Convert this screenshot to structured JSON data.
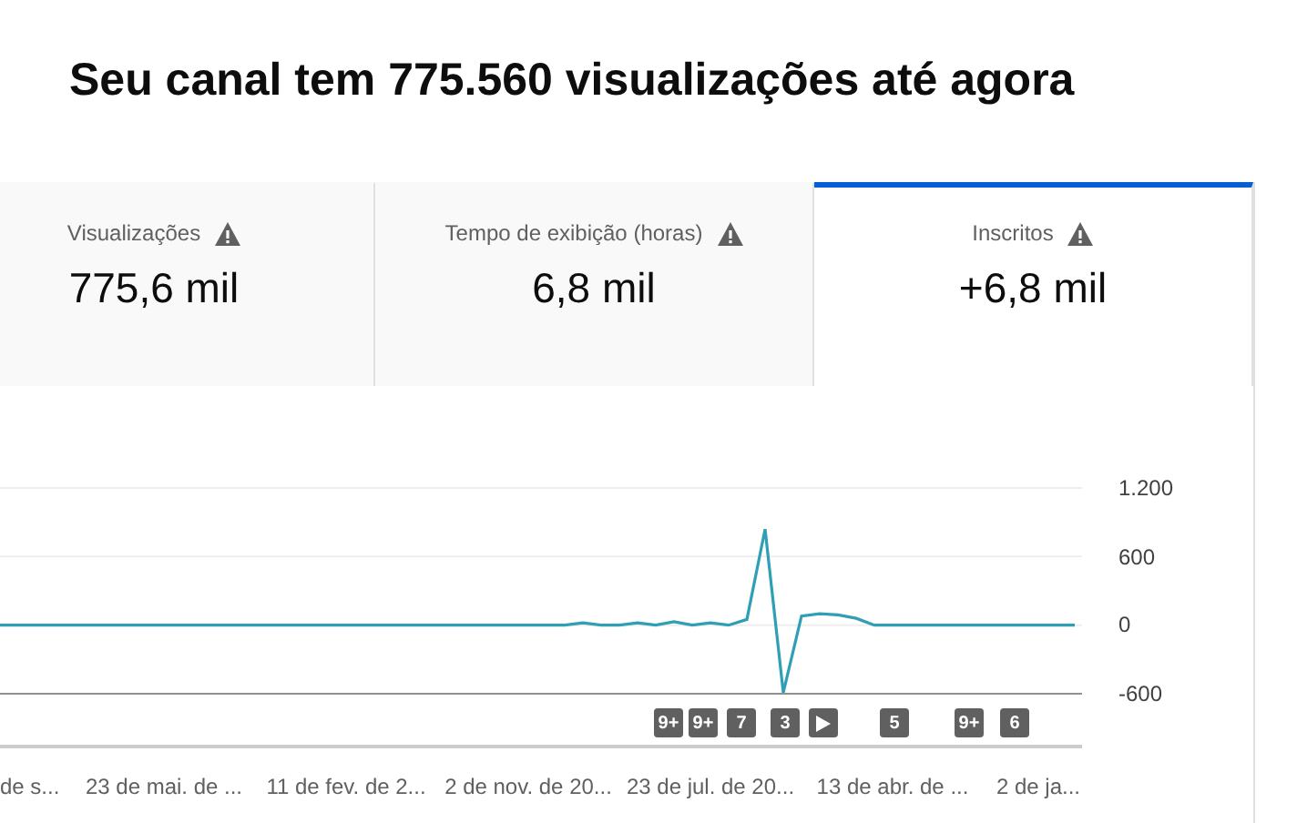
{
  "title": "Seu canal tem 775.560 visualizações até agora",
  "tabs": [
    {
      "label": "Visualizações",
      "value": "775,6 mil",
      "selected": false
    },
    {
      "label": "Tempo de exibição (horas)",
      "value": "6,8 mil",
      "selected": false
    },
    {
      "label": "Inscritos",
      "value": "+6,8 mil",
      "selected": true
    }
  ],
  "chart": {
    "chart_data": {
      "type": "line",
      "ylim": [
        -600,
        1200
      ],
      "yticks": [
        {
          "value": 1200,
          "label": "1.200"
        },
        {
          "value": 600,
          "label": "600"
        },
        {
          "value": 0,
          "label": "0"
        },
        {
          "value": -600,
          "label": "-600"
        }
      ],
      "series": [
        {
          "color": "#2f9fb5",
          "values": [
            0,
            0,
            0,
            0,
            0,
            0,
            0,
            0,
            0,
            0,
            0,
            0,
            0,
            0,
            0,
            0,
            0,
            0,
            0,
            0,
            0,
            0,
            0,
            0,
            0,
            0,
            0,
            0,
            0,
            0,
            0,
            0,
            20,
            0,
            0,
            20,
            0,
            30,
            0,
            20,
            0,
            50,
            840,
            -590,
            80,
            100,
            90,
            60,
            0,
            0,
            0,
            0,
            0,
            0,
            0,
            0,
            0,
            0,
            0,
            0
          ]
        }
      ]
    },
    "x_axis": [
      "de s...",
      "23 de mai. de ...",
      "11 de fev. de 2...",
      "2 de nov. de 20...",
      "23 de jul. de 20...",
      "13 de abr. de ...",
      "2 de ja..."
    ],
    "markers": [
      {
        "kind": "text",
        "label": "9+"
      },
      {
        "kind": "text",
        "label": "9+"
      },
      {
        "kind": "text",
        "label": "7"
      },
      {
        "kind": "text",
        "label": "3"
      },
      {
        "kind": "play"
      },
      {
        "kind": "text",
        "label": "5"
      },
      {
        "kind": "text",
        "label": "9+"
      },
      {
        "kind": "text",
        "label": "6"
      }
    ]
  }
}
